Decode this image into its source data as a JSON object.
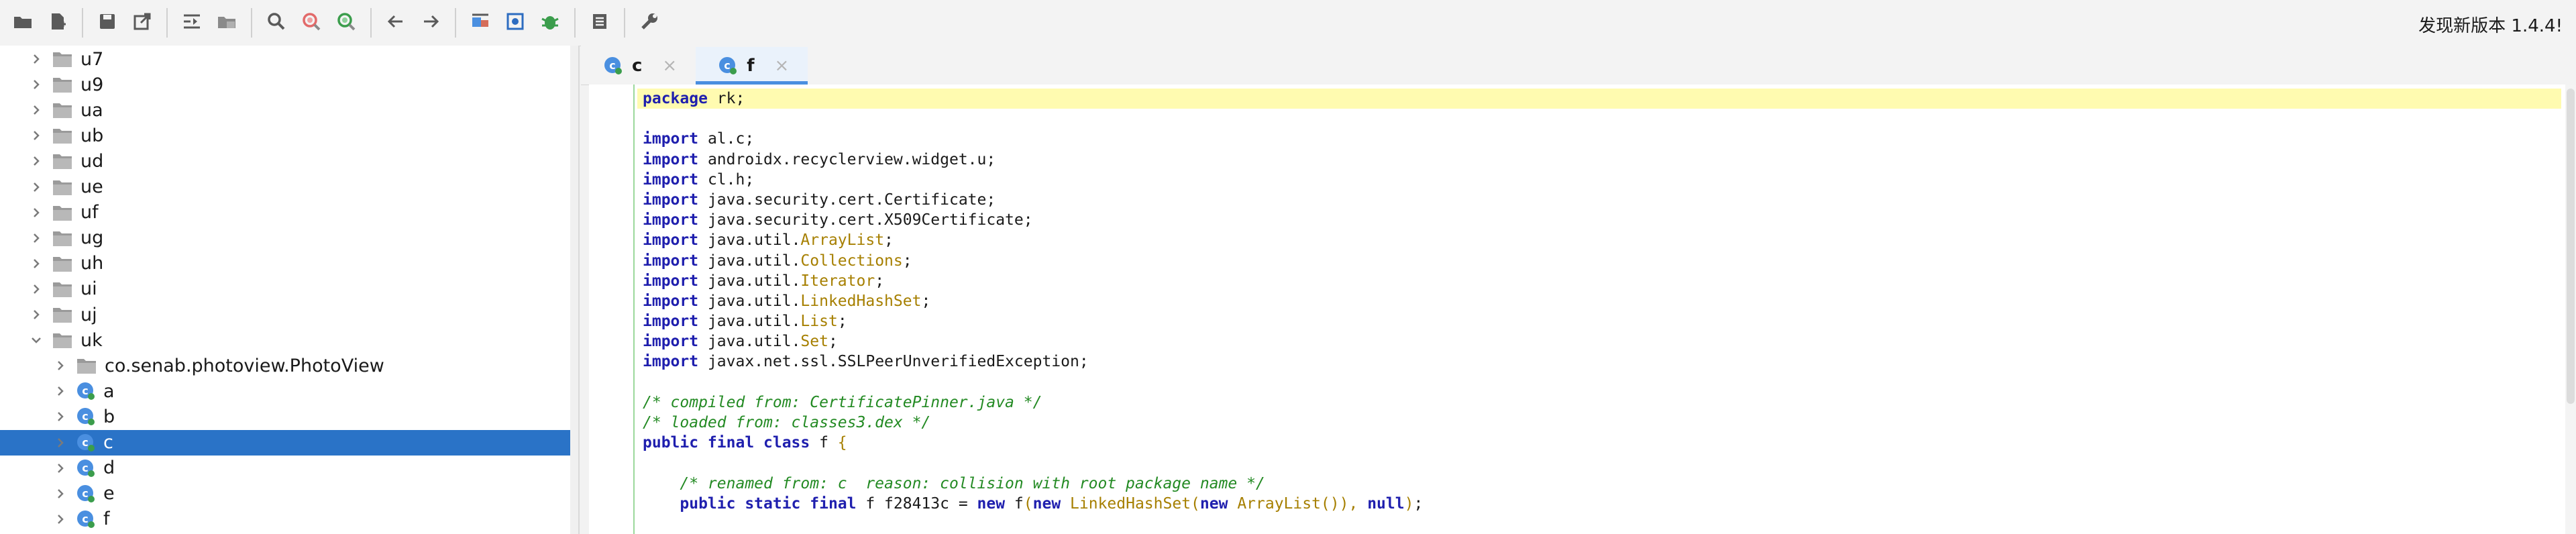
{
  "toolbar": {
    "icons": [
      "open-folder-icon",
      "add-file-icon",
      "save-icon",
      "export-icon",
      "decompile-icon",
      "folder-sync-icon",
      "search-icon",
      "find-class-icon",
      "find-usage-icon",
      "back-arrow-icon",
      "forward-arrow-icon",
      "image-icon",
      "fullscreen-icon",
      "debug-icon",
      "log-icon",
      "wrench-icon"
    ],
    "update_text": "发现新版本 1.4.4!"
  },
  "tree": {
    "rows": [
      {
        "label": "u7",
        "type": "folder",
        "expanded": false
      },
      {
        "label": "u9",
        "type": "folder",
        "expanded": false
      },
      {
        "label": "ua",
        "type": "folder",
        "expanded": false
      },
      {
        "label": "ub",
        "type": "folder",
        "expanded": false
      },
      {
        "label": "ud",
        "type": "folder",
        "expanded": false
      },
      {
        "label": "ue",
        "type": "folder",
        "expanded": false
      },
      {
        "label": "uf",
        "type": "folder",
        "expanded": false
      },
      {
        "label": "ug",
        "type": "folder",
        "expanded": false
      },
      {
        "label": "uh",
        "type": "folder",
        "expanded": false
      },
      {
        "label": "ui",
        "type": "folder",
        "expanded": false
      },
      {
        "label": "uj",
        "type": "folder",
        "expanded": false
      },
      {
        "label": "uk",
        "type": "folder",
        "expanded": true
      },
      {
        "label": "co.senab.photoview.PhotoView",
        "type": "folder",
        "expanded": false
      },
      {
        "label": "a",
        "type": "class",
        "expanded": false
      },
      {
        "label": "b",
        "type": "class",
        "expanded": false
      },
      {
        "label": "c",
        "type": "class",
        "expanded": false,
        "selected": true
      },
      {
        "label": "d",
        "type": "class",
        "expanded": false
      },
      {
        "label": "e",
        "type": "class",
        "expanded": false
      },
      {
        "label": "f",
        "type": "class",
        "expanded": false
      }
    ]
  },
  "tabs": [
    {
      "label": "c",
      "active": false
    },
    {
      "label": "f",
      "active": true
    }
  ],
  "editor": {
    "lines": [
      [
        [
          "kw",
          "package"
        ],
        [
          "t",
          " rk;"
        ]
      ],
      [],
      [
        [
          "kw",
          "import"
        ],
        [
          "t",
          " al.c;"
        ]
      ],
      [
        [
          "kw",
          "import"
        ],
        [
          "t",
          " androidx.recyclerview.widget.u;"
        ]
      ],
      [
        [
          "kw",
          "import"
        ],
        [
          "t",
          " cl.h;"
        ]
      ],
      [
        [
          "kw",
          "import"
        ],
        [
          "t",
          " java.security.cert.Certificate;"
        ]
      ],
      [
        [
          "kw",
          "import"
        ],
        [
          "t",
          " java.security.cert.X509Certificate;"
        ]
      ],
      [
        [
          "kw",
          "import"
        ],
        [
          "t",
          " java.util."
        ],
        [
          "cls",
          "ArrayList"
        ],
        [
          "t",
          ";"
        ]
      ],
      [
        [
          "kw",
          "import"
        ],
        [
          "t",
          " java.util."
        ],
        [
          "cls",
          "Collections"
        ],
        [
          "t",
          ";"
        ]
      ],
      [
        [
          "kw",
          "import"
        ],
        [
          "t",
          " java.util."
        ],
        [
          "cls",
          "Iterator"
        ],
        [
          "t",
          ";"
        ]
      ],
      [
        [
          "kw",
          "import"
        ],
        [
          "t",
          " java.util."
        ],
        [
          "cls",
          "LinkedHashSet"
        ],
        [
          "t",
          ";"
        ]
      ],
      [
        [
          "kw",
          "import"
        ],
        [
          "t",
          " java.util."
        ],
        [
          "cls",
          "List"
        ],
        [
          "t",
          ";"
        ]
      ],
      [
        [
          "kw",
          "import"
        ],
        [
          "t",
          " java.util."
        ],
        [
          "cls",
          "Set"
        ],
        [
          "t",
          ";"
        ]
      ],
      [
        [
          "kw",
          "import"
        ],
        [
          "t",
          " javax.net.ssl.SSLPeerUnverifiedException;"
        ]
      ],
      [],
      [
        [
          "cmt",
          "/* compiled from: CertificatePinner.java */"
        ]
      ],
      [
        [
          "cmt",
          "/* loaded from: classes3.dex */"
        ]
      ],
      [
        [
          "kw",
          "public final class"
        ],
        [
          "t",
          " f "
        ],
        [
          "cls",
          "{"
        ]
      ],
      [],
      [
        [
          "t",
          "    "
        ],
        [
          "cmt",
          "/* renamed from: c  reason: collision with root package name */"
        ]
      ],
      [
        [
          "t",
          "    "
        ],
        [
          "kw",
          "public static final"
        ],
        [
          "t",
          " f f28413c = "
        ],
        [
          "kw",
          "new"
        ],
        [
          "t",
          " f"
        ],
        [
          "cls",
          "("
        ],
        [
          "kw",
          "new"
        ],
        [
          "t",
          " "
        ],
        [
          "cls",
          "LinkedHashSet("
        ],
        [
          "kw",
          "new"
        ],
        [
          "t",
          " "
        ],
        [
          "cls",
          "ArrayList()),"
        ],
        [
          "t",
          " "
        ],
        [
          "kw",
          "null"
        ],
        [
          "cls",
          ")"
        ],
        [
          "t",
          ";"
        ]
      ]
    ]
  },
  "colors": {
    "selection": "#2a73c7",
    "keyword": "#1f1fae",
    "class_ref": "#a67f00",
    "comment": "#238a23",
    "current_line": "#fffbb0"
  }
}
